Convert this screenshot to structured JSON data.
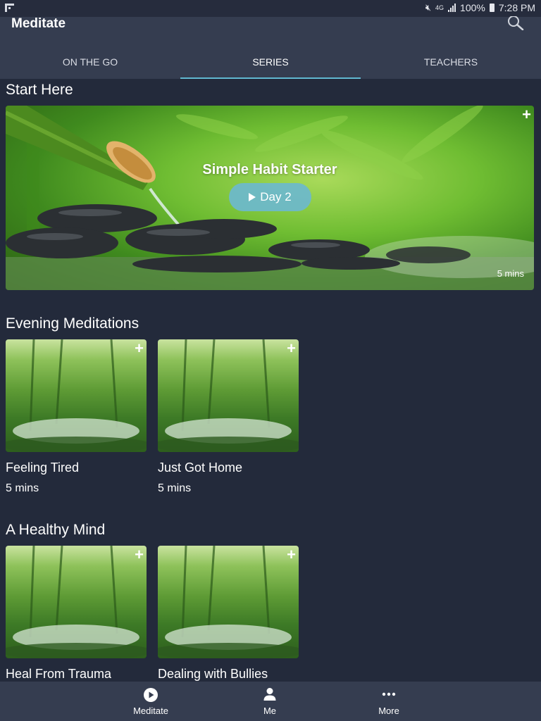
{
  "status_bar": {
    "battery": "100%",
    "time": "7:28 PM",
    "network": "4G"
  },
  "app_bar": {
    "title": "Meditate"
  },
  "tabs": [
    {
      "label": "ON THE GO"
    },
    {
      "label": "SERIES",
      "active": true
    },
    {
      "label": "TEACHERS"
    }
  ],
  "sections": {
    "start_here": {
      "title": "Start Here",
      "hero": {
        "title": "Simple Habit Starter",
        "button_label": "Day 2",
        "duration": "5 mins"
      }
    },
    "evening": {
      "title": "Evening Meditations",
      "cards": [
        {
          "title": "Feeling Tired",
          "duration": "5 mins"
        },
        {
          "title": "Just Got Home",
          "duration": "5 mins"
        }
      ]
    },
    "healthy_mind": {
      "title": "A Healthy Mind",
      "cards": [
        {
          "title": "Heal From Trauma"
        },
        {
          "title": "Dealing with Bullies"
        }
      ]
    }
  },
  "bottom_nav": [
    {
      "label": "Meditate",
      "icon": "play-circle-icon"
    },
    {
      "label": "Me",
      "icon": "person-icon"
    },
    {
      "label": "More",
      "icon": "more-dots-icon"
    }
  ],
  "colors": {
    "background": "#232a3b",
    "bar": "#353d50",
    "accent": "#61b8d1",
    "play_button": "#6cb8cd"
  }
}
